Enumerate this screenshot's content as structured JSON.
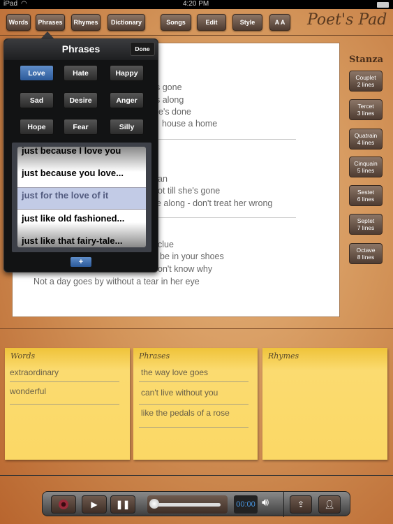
{
  "status": {
    "device": "iPad",
    "time": "4:20 PM"
  },
  "toolbar": {
    "items": [
      "Words",
      "Phrases",
      "Rhymes",
      "Dictionary",
      "Songs",
      "Edit",
      "Style",
      "A A"
    ],
    "logo": "Poet's Pad"
  },
  "editor": {
    "lines": [
      {
        "text": "s gone"
      },
      {
        "text": "s along"
      },
      {
        "text": "e's done"
      },
      {
        "text": "house a home"
      },
      {
        "text": "an"
      },
      {
        "text": "ot till she's gone"
      },
      {
        "text": "e along - don't treat her wrong"
      },
      {
        "text": "clue"
      },
      {
        "text": "be in your shoes"
      },
      {
        "text": "on't know why"
      },
      {
        "text": "Not a day goes by without a tear in her eye"
      }
    ]
  },
  "stanza": {
    "title": "Stanza",
    "items": [
      {
        "name": "Couplet",
        "lines": "2 lines"
      },
      {
        "name": "Tercet",
        "lines": "3 lines"
      },
      {
        "name": "Quatrain",
        "lines": "4 lines"
      },
      {
        "name": "Cinquain",
        "lines": "5 lines"
      },
      {
        "name": "Sestet",
        "lines": "6 lines"
      },
      {
        "name": "Septet",
        "lines": "7 lines"
      },
      {
        "name": "Octave",
        "lines": "8 lines"
      }
    ]
  },
  "popover": {
    "title": "Phrases",
    "done": "Done",
    "selected_category": "Love",
    "categories": [
      "Love",
      "Hate",
      "Happy",
      "Sad",
      "Desire",
      "Anger",
      "Hope",
      "Fear",
      "Silly"
    ],
    "picker": [
      "just because I love you",
      "just because you love...",
      "just for the love of it",
      "just like old fashioned...",
      "just like that fairy-tale..."
    ],
    "selected_phrase": "just for the love of it",
    "add": "+"
  },
  "notes": [
    {
      "title": "Words",
      "items": [
        "extraordinary",
        "wonderful"
      ]
    },
    {
      "title": "Phrases",
      "items": [
        "the way love goes",
        "can't live without you",
        "like the pedals of a rose"
      ]
    },
    {
      "title": "Rhymes",
      "items": []
    }
  ],
  "player": {
    "time": "00:00",
    "progress": 0
  },
  "colors": {
    "accent": "#2c5a9a",
    "time_text": "#4a9ae8",
    "note": "#fbd865"
  }
}
